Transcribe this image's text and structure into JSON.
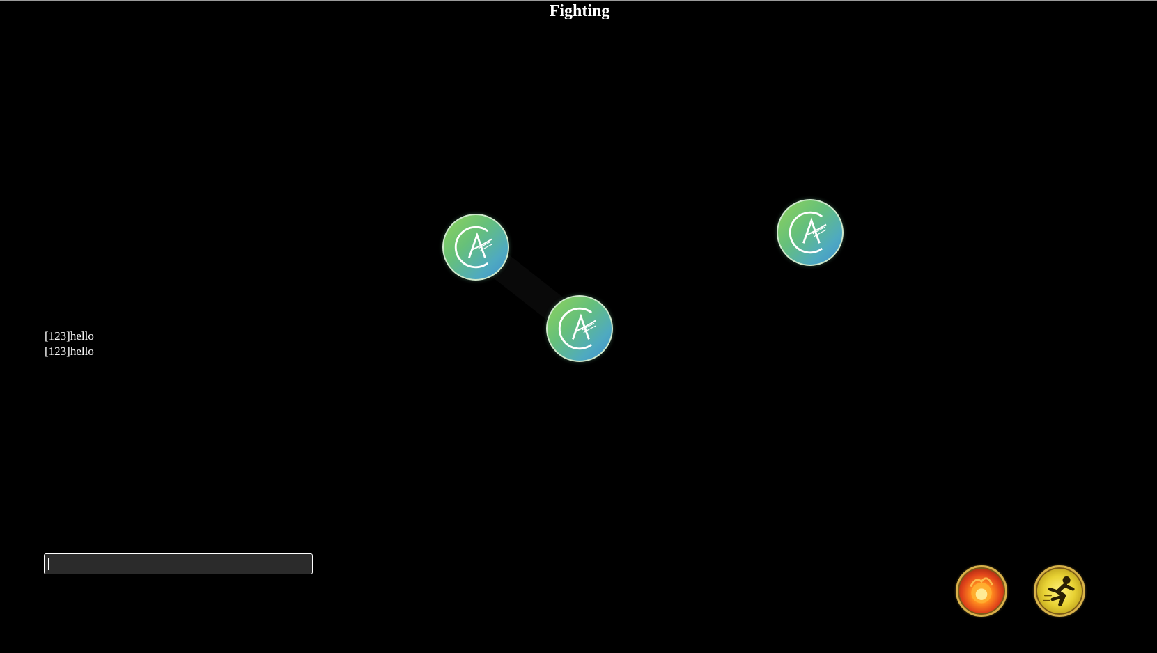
{
  "game": {
    "title": "Fighting"
  },
  "players": [
    {
      "name": "player-avatar-1",
      "icon": "ca-logo-icon"
    },
    {
      "name": "player-avatar-2",
      "icon": "ca-logo-icon"
    },
    {
      "name": "player-avatar-3",
      "icon": "ca-logo-icon"
    }
  ],
  "chat": {
    "messages": [
      "[123]hello",
      "[123]hello"
    ],
    "input_value": "",
    "input_placeholder": ""
  },
  "skills": [
    {
      "name": "fireball-skill",
      "icon": "fireball-icon"
    },
    {
      "name": "dash-skill",
      "icon": "dash-runner-icon"
    }
  ],
  "colors": {
    "background": "#000000",
    "text": "#ffffff",
    "input_background": "#2b2b2b",
    "skill_border": "#d8b24a"
  }
}
